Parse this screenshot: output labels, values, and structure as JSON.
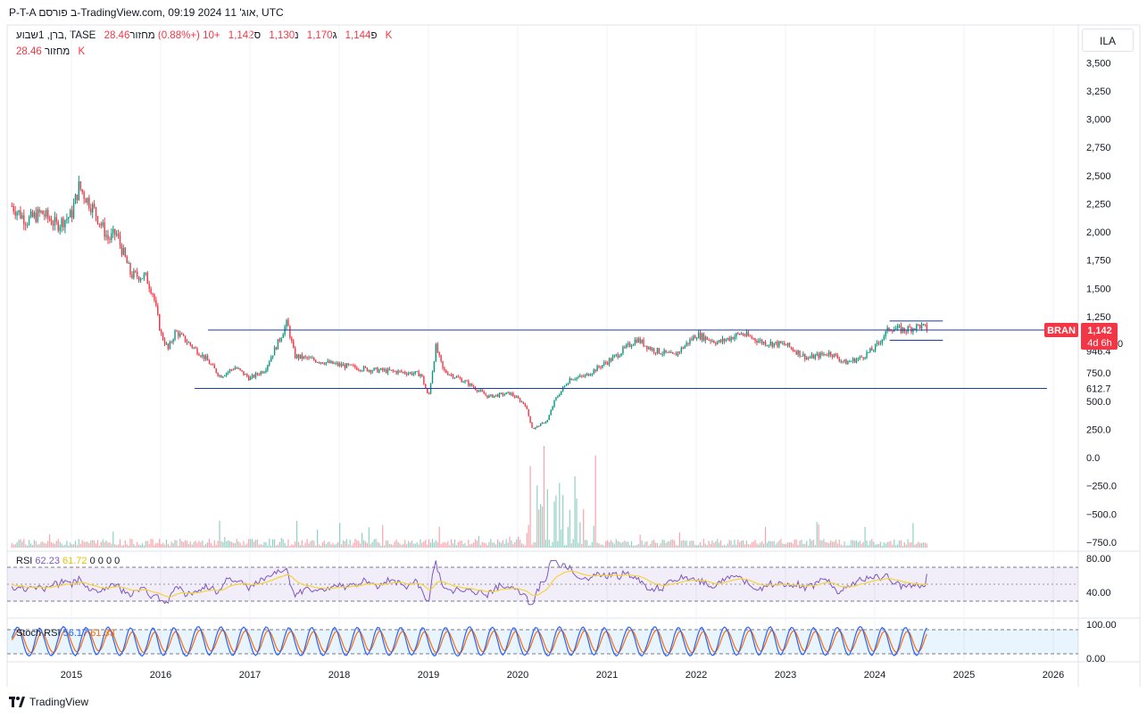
{
  "header": {
    "title": "P-T-A ב פורסם-TradingView.com, 09:19 2024 אוג' 11, UTC"
  },
  "legend": {
    "symbol": "ברן, 1שבוע, TASE",
    "open_label": "פ",
    "open": "1,144",
    "high_label": "ג",
    "high": "1,170",
    "low_label": "נ",
    "low": "1,130",
    "close_label": "ס",
    "close": "1,142",
    "change": "+10 (+0.88%)",
    "volume_label": "מחזור",
    "volume": "28.46 K",
    "volume_line_label": "מחזור",
    "volume_line_value": "28.46 K"
  },
  "currency_button": "ILA",
  "price_axis": {
    "ticks": [
      "3,500",
      "3,250",
      "3,000",
      "2,750",
      "2,500",
      "2,250",
      "2,000",
      "1,750",
      "1,500",
      "1,250",
      "946.4",
      "750.0",
      "612.7",
      "500.0",
      "250.0",
      "0.0",
      "−250.0",
      "−500.0",
      "−750.0"
    ],
    "partial_label": "0"
  },
  "last_price_badge": {
    "symbol": "BRAN",
    "price": "1,142",
    "countdown": "4d 6h"
  },
  "rsi_pane": {
    "label": "RSI",
    "value1": "62.23",
    "value2": "61.72",
    "zeros": "0  0  0  0",
    "ticks": [
      "80.00",
      "40.00"
    ]
  },
  "stoch_pane": {
    "label": "Stoch RSI",
    "k": "56.17",
    "d": "61.33",
    "ticks": [
      "100.00",
      "0.00"
    ]
  },
  "time_axis": [
    "2015",
    "2016",
    "2017",
    "2018",
    "2019",
    "2020",
    "2021",
    "2022",
    "2023",
    "2024",
    "2025",
    "2026"
  ],
  "footer": {
    "brand": "TradingView"
  },
  "colors": {
    "up": "#089981",
    "down": "#f23645",
    "level_line": "#1e3aa8",
    "rsi": "#7e57c2",
    "rsi_ma": "#f5d33a",
    "stoch_k": "#2962ff",
    "stoch_d": "#ff6d00"
  },
  "chart_data": {
    "type": "candlestick",
    "interval": "1 week",
    "symbol": "BRAN (TASE)",
    "y_range": [
      -800,
      3650
    ],
    "x_range": [
      "2014-05",
      "2026-03"
    ],
    "price_points": [
      [
        "2014-05",
        2230
      ],
      [
        "2014-07",
        2100
      ],
      [
        "2014-09",
        2170
      ],
      [
        "2014-11",
        2060
      ],
      [
        "2015-01",
        2150
      ],
      [
        "2015-02",
        2400
      ],
      [
        "2015-04",
        2200
      ],
      [
        "2015-06",
        1930
      ],
      [
        "2015-07",
        1990
      ],
      [
        "2015-09",
        1620
      ],
      [
        "2015-11",
        1600
      ],
      [
        "2015-12",
        1450
      ],
      [
        "2016-01",
        1100
      ],
      [
        "2016-02",
        960
      ],
      [
        "2016-03",
        1120
      ],
      [
        "2016-05",
        1000
      ],
      [
        "2016-07",
        880
      ],
      [
        "2016-09",
        720
      ],
      [
        "2016-11",
        800
      ],
      [
        "2017-01",
        700
      ],
      [
        "2017-03",
        780
      ],
      [
        "2017-05",
        1050
      ],
      [
        "2017-06",
        1200
      ],
      [
        "2017-07",
        900
      ],
      [
        "2017-10",
        860
      ],
      [
        "2018-01",
        820
      ],
      [
        "2018-05",
        780
      ],
      [
        "2018-09",
        760
      ],
      [
        "2018-12",
        740
      ],
      [
        "2019-01",
        530
      ],
      [
        "2019-02",
        980
      ],
      [
        "2019-03",
        770
      ],
      [
        "2019-06",
        670
      ],
      [
        "2019-09",
        540
      ],
      [
        "2019-12",
        570
      ],
      [
        "2020-02",
        470
      ],
      [
        "2020-03",
        250
      ],
      [
        "2020-05",
        330
      ],
      [
        "2020-06",
        510
      ],
      [
        "2020-08",
        700
      ],
      [
        "2020-10",
        720
      ],
      [
        "2021-02",
        890
      ],
      [
        "2021-05",
        1050
      ],
      [
        "2021-07",
        960
      ],
      [
        "2021-10",
        900
      ],
      [
        "2022-01",
        1090
      ],
      [
        "2022-04",
        1020
      ],
      [
        "2022-07",
        1100
      ],
      [
        "2022-10",
        1020
      ],
      [
        "2023-01",
        1000
      ],
      [
        "2023-04",
        880
      ],
      [
        "2023-07",
        930
      ],
      [
        "2023-09",
        840
      ],
      [
        "2023-11",
        880
      ],
      [
        "2024-01",
        970
      ],
      [
        "2024-03",
        1150
      ],
      [
        "2024-05",
        1130
      ],
      [
        "2024-07",
        1170
      ],
      [
        "2024-08",
        1142
      ]
    ],
    "horizontal_levels": [
      1130,
      612.7
    ],
    "range_box": {
      "from": "2024-03",
      "to": "2024-08",
      "top": 1210,
      "bottom": 1040
    },
    "rsi": {
      "last": 62.23,
      "ma_last": 61.72
    },
    "stoch_rsi": {
      "k_last": 56.17,
      "d_last": 61.33
    }
  }
}
